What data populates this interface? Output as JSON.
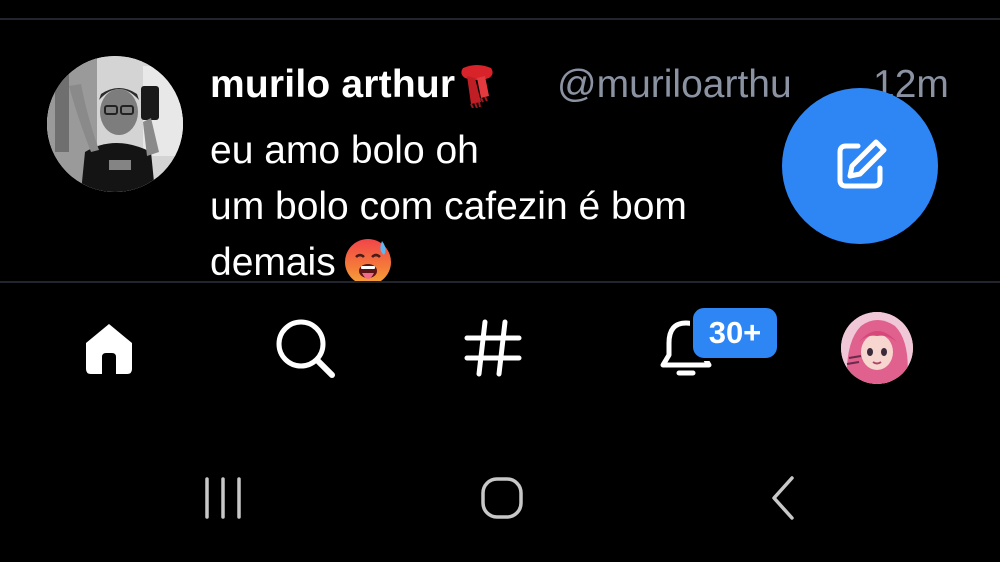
{
  "post": {
    "author_name": "murilo arthur",
    "author_handle": "@muriloarthu",
    "time": "12m",
    "text_lines": [
      "eu amo bolo oh",
      "um bolo com cafezin é bom",
      "demais"
    ],
    "name_emoji": "scarf-emoji",
    "text_emoji": "hot-face-emoji"
  },
  "compose": {
    "icon": "compose-icon",
    "color": "#2e86f5"
  },
  "bottom_nav": {
    "items": [
      {
        "id": "home",
        "icon": "home-icon"
      },
      {
        "id": "search",
        "icon": "search-icon"
      },
      {
        "id": "feeds",
        "icon": "hashtag-icon"
      },
      {
        "id": "notifications",
        "icon": "bell-icon"
      },
      {
        "id": "profile",
        "icon": "avatar"
      }
    ],
    "notifications_badge": "30+",
    "badge_color": "#2e86f5"
  },
  "system_nav": {
    "buttons": [
      "recents-icon",
      "home-circle-icon",
      "back-icon"
    ]
  },
  "colors": {
    "background": "#000000",
    "text": "#ffffff",
    "muted": "#8b93a3",
    "accent": "#2e86f5",
    "divider": "#22252e"
  }
}
